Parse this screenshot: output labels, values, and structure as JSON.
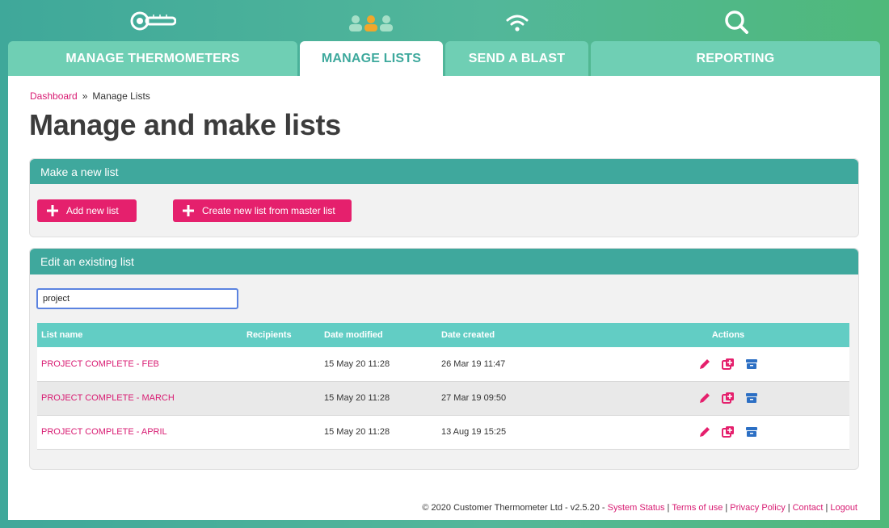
{
  "nav": {
    "icons": [
      "thermometer-icon",
      "users-icon",
      "wifi-icon",
      "search-icon"
    ],
    "tabs": [
      {
        "label": "MANAGE THERMOMETERS"
      },
      {
        "label": "MANAGE LISTS"
      },
      {
        "label": "SEND A BLAST"
      },
      {
        "label": "REPORTING"
      }
    ],
    "active_tab": 1
  },
  "breadcrumb": {
    "home": "Dashboard",
    "separator": "»",
    "current": "Manage Lists"
  },
  "page_title": "Manage and make lists",
  "new_list": {
    "heading": "Make a new list",
    "add_label": "Add new list",
    "from_master_label": "Create new list from master list"
  },
  "existing": {
    "heading": "Edit an existing list",
    "search_value": "project",
    "columns": {
      "name": "List name",
      "recipients": "Recipients",
      "modified": "Date modified",
      "created": "Date created",
      "actions": "Actions"
    },
    "rows": [
      {
        "name": "PROJECT COMPLETE - FEB",
        "recipients": "",
        "modified": "15 May 20 11:28",
        "created": "26 Mar 19 11:47"
      },
      {
        "name": "PROJECT COMPLETE - MARCH",
        "recipients": "",
        "modified": "15 May 20 11:28",
        "created": "27 Mar 19 09:50"
      },
      {
        "name": "PROJECT COMPLETE - APRIL",
        "recipients": "",
        "modified": "15 May 20 11:28",
        "created": "13 Aug 19 15:25"
      }
    ]
  },
  "footer": {
    "copyright": "© 2020 Customer Thermometer Ltd - v2.5.20 -",
    "links": [
      "System Status",
      "Terms of use",
      "Privacy Policy",
      "Contact",
      "Logout"
    ]
  },
  "colors": {
    "accent_pink": "#e5206d",
    "header_teal": "#3fa89d",
    "table_head": "#62cdc4",
    "tab_inactive": "#6fcfb4"
  }
}
